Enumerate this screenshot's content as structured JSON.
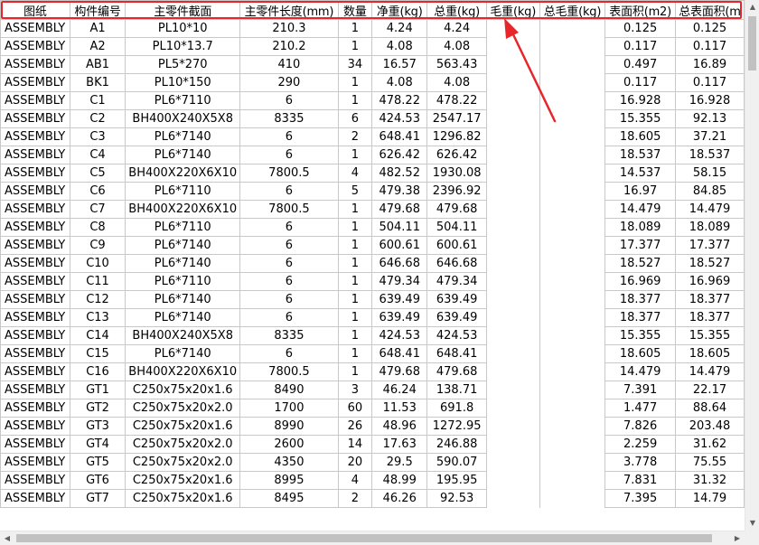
{
  "table": {
    "columns": [
      "图纸",
      "构件编号",
      "主零件截面",
      "主零件长度(mm)",
      "数量",
      "净重(kg)",
      "总重(kg)",
      "毛重(kg)",
      "总毛重(kg)",
      "表面积(m2)",
      "总表面积(m"
    ],
    "rows": [
      [
        "ASSEMBLY",
        "A1",
        "PL10*10",
        "210.3",
        "1",
        "4.24",
        "4.24",
        "",
        "",
        "0.125",
        "0.125"
      ],
      [
        "ASSEMBLY",
        "A2",
        "PL10*13.7",
        "210.2",
        "1",
        "4.08",
        "4.08",
        "",
        "",
        "0.117",
        "0.117"
      ],
      [
        "ASSEMBLY",
        "AB1",
        "PL5*270",
        "410",
        "34",
        "16.57",
        "563.43",
        "",
        "",
        "0.497",
        "16.89"
      ],
      [
        "ASSEMBLY",
        "BK1",
        "PL10*150",
        "290",
        "1",
        "4.08",
        "4.08",
        "",
        "",
        "0.117",
        "0.117"
      ],
      [
        "ASSEMBLY",
        "C1",
        "PL6*7110",
        "6",
        "1",
        "478.22",
        "478.22",
        "",
        "",
        "16.928",
        "16.928"
      ],
      [
        "ASSEMBLY",
        "C2",
        "BH400X240X5X8",
        "8335",
        "6",
        "424.53",
        "2547.17",
        "",
        "",
        "15.355",
        "92.13"
      ],
      [
        "ASSEMBLY",
        "C3",
        "PL6*7140",
        "6",
        "2",
        "648.41",
        "1296.82",
        "",
        "",
        "18.605",
        "37.21"
      ],
      [
        "ASSEMBLY",
        "C4",
        "PL6*7140",
        "6",
        "1",
        "626.42",
        "626.42",
        "",
        "",
        "18.537",
        "18.537"
      ],
      [
        "ASSEMBLY",
        "C5",
        "BH400X220X6X10",
        "7800.5",
        "4",
        "482.52",
        "1930.08",
        "",
        "",
        "14.537",
        "58.15"
      ],
      [
        "ASSEMBLY",
        "C6",
        "PL6*7110",
        "6",
        "5",
        "479.38",
        "2396.92",
        "",
        "",
        "16.97",
        "84.85"
      ],
      [
        "ASSEMBLY",
        "C7",
        "BH400X220X6X10",
        "7800.5",
        "1",
        "479.68",
        "479.68",
        "",
        "",
        "14.479",
        "14.479"
      ],
      [
        "ASSEMBLY",
        "C8",
        "PL6*7110",
        "6",
        "1",
        "504.11",
        "504.11",
        "",
        "",
        "18.089",
        "18.089"
      ],
      [
        "ASSEMBLY",
        "C9",
        "PL6*7140",
        "6",
        "1",
        "600.61",
        "600.61",
        "",
        "",
        "17.377",
        "17.377"
      ],
      [
        "ASSEMBLY",
        "C10",
        "PL6*7140",
        "6",
        "1",
        "646.68",
        "646.68",
        "",
        "",
        "18.527",
        "18.527"
      ],
      [
        "ASSEMBLY",
        "C11",
        "PL6*7110",
        "6",
        "1",
        "479.34",
        "479.34",
        "",
        "",
        "16.969",
        "16.969"
      ],
      [
        "ASSEMBLY",
        "C12",
        "PL6*7140",
        "6",
        "1",
        "639.49",
        "639.49",
        "",
        "",
        "18.377",
        "18.377"
      ],
      [
        "ASSEMBLY",
        "C13",
        "PL6*7140",
        "6",
        "1",
        "639.49",
        "639.49",
        "",
        "",
        "18.377",
        "18.377"
      ],
      [
        "ASSEMBLY",
        "C14",
        "BH400X240X5X8",
        "8335",
        "1",
        "424.53",
        "424.53",
        "",
        "",
        "15.355",
        "15.355"
      ],
      [
        "ASSEMBLY",
        "C15",
        "PL6*7140",
        "6",
        "1",
        "648.41",
        "648.41",
        "",
        "",
        "18.605",
        "18.605"
      ],
      [
        "ASSEMBLY",
        "C16",
        "BH400X220X6X10",
        "7800.5",
        "1",
        "479.68",
        "479.68",
        "",
        "",
        "14.479",
        "14.479"
      ],
      [
        "ASSEMBLY",
        "GT1",
        "C250x75x20x1.6",
        "8490",
        "3",
        "46.24",
        "138.71",
        "",
        "",
        "7.391",
        "22.17"
      ],
      [
        "ASSEMBLY",
        "GT2",
        "C250x75x20x2.0",
        "1700",
        "60",
        "11.53",
        "691.8",
        "",
        "",
        "1.477",
        "88.64"
      ],
      [
        "ASSEMBLY",
        "GT3",
        "C250x75x20x1.6",
        "8990",
        "26",
        "48.96",
        "1272.95",
        "",
        "",
        "7.826",
        "203.48"
      ],
      [
        "ASSEMBLY",
        "GT4",
        "C250x75x20x2.0",
        "2600",
        "14",
        "17.63",
        "246.88",
        "",
        "",
        "2.259",
        "31.62"
      ],
      [
        "ASSEMBLY",
        "GT5",
        "C250x75x20x2.0",
        "4350",
        "20",
        "29.5",
        "590.07",
        "",
        "",
        "3.778",
        "75.55"
      ],
      [
        "ASSEMBLY",
        "GT6",
        "C250x75x20x1.6",
        "8995",
        "4",
        "48.99",
        "195.95",
        "",
        "",
        "7.831",
        "31.32"
      ],
      [
        "ASSEMBLY",
        "GT7",
        "C250x75x20x1.6",
        "8495",
        "2",
        "46.26",
        "92.53",
        "",
        "",
        "7.395",
        "14.79"
      ]
    ]
  },
  "colors": {
    "highlight": "#e8262a",
    "gridline": "#c8c8c8"
  },
  "icons": {
    "annotation": "red-arrow-icon",
    "scroll_up": "triangle-up-icon",
    "scroll_down": "triangle-down-icon",
    "scroll_left": "triangle-left-icon",
    "scroll_right": "triangle-right-icon"
  }
}
